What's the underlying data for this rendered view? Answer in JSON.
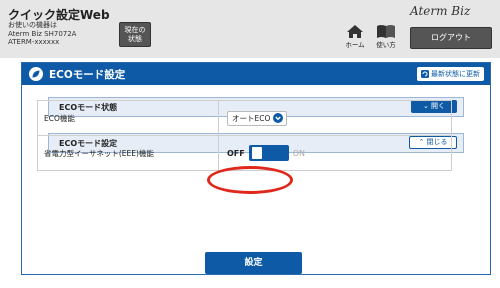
{
  "header": {
    "app_title": "クイック設定Web",
    "device_line1": "お使いの機器は",
    "device_line2": "Aterm Biz SH7072A",
    "device_line3": "ATERM-xxxxxx",
    "status_button_line1": "現在の",
    "status_button_line2": "状態",
    "home_label": "ホーム",
    "help_label": "使い方",
    "brand": "Aterm Biz",
    "logout_label": "ログアウト"
  },
  "panel": {
    "title": "ECOモード設定",
    "refresh_label": "最新状態に更新"
  },
  "sections": {
    "status": {
      "label": "ECOモード状態",
      "button": "開く"
    },
    "settings": {
      "label": "ECOモード設定",
      "button": "閉じる"
    }
  },
  "rows": {
    "eco_function": {
      "label": "ECO機能",
      "value": "オートECO"
    },
    "eee": {
      "label": "省電力型イーサネット(EEE)機能",
      "off_label": "OFF",
      "on_label": "ON"
    }
  },
  "apply_label": "設定",
  "colors": {
    "accent": "#0e5aa7",
    "highlight": "#e0281d"
  }
}
